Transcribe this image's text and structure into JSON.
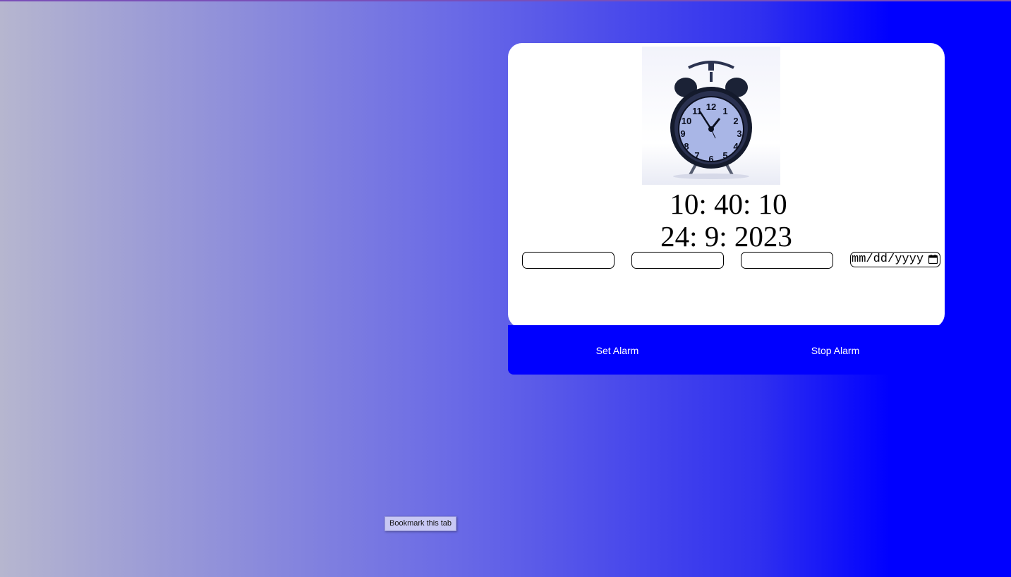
{
  "clock": {
    "time": "10: 40: 10",
    "date": "24: 9: 2023"
  },
  "inputs": {
    "hour_value": "",
    "minute_value": "",
    "second_value": "",
    "date_placeholder": "mm/dd/yyyy"
  },
  "buttons": {
    "set_label": "Set Alarm",
    "stop_label": "Stop Alarm"
  },
  "tooltip": {
    "text": "Bookmark this tab"
  },
  "image": {
    "icon": "alarm-clock-icon",
    "face_numbers": [
      "12",
      "1",
      "2",
      "3",
      "4",
      "5",
      "6",
      "7",
      "8",
      "9",
      "10",
      "11"
    ]
  },
  "colors": {
    "accent": "#0000ff",
    "card": "#ffffff"
  }
}
